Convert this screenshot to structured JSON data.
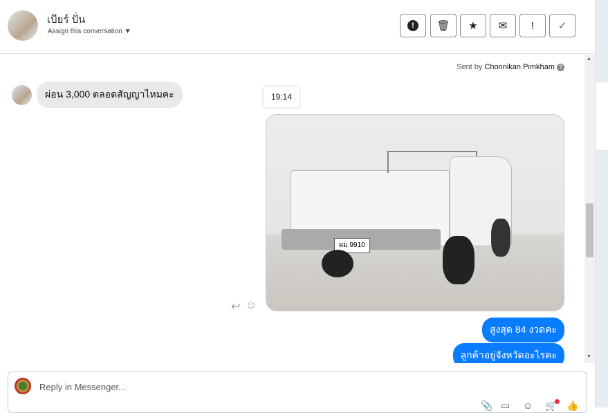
{
  "header": {
    "name": "เบียร์ ปั่น",
    "assign_label": "Assign this conversation",
    "buttons": [
      {
        "name": "spam",
        "glyph": "!"
      },
      {
        "name": "delete",
        "glyph": "🗑"
      },
      {
        "name": "star",
        "glyph": "★"
      },
      {
        "name": "mark-unread",
        "glyph": "✉"
      },
      {
        "name": "follow-up",
        "glyph": "!"
      },
      {
        "name": "done",
        "glyph": "✓"
      }
    ]
  },
  "chat": {
    "sent_by_prefix": "Sent by",
    "sent_by_name": "Chonnikan Pimkham",
    "incoming": "ผ่อน 3,000 ตลอดสัญญาไหมคะ",
    "timestamp": "19:14",
    "photo_plate": "ผม 9910",
    "outgoing": [
      "สูงสุด 84 งวดคะ",
      "ลูกค้าอยู่จังหวัดอะไรคะ"
    ]
  },
  "composer": {
    "placeholder": "Reply in Messenger..."
  }
}
